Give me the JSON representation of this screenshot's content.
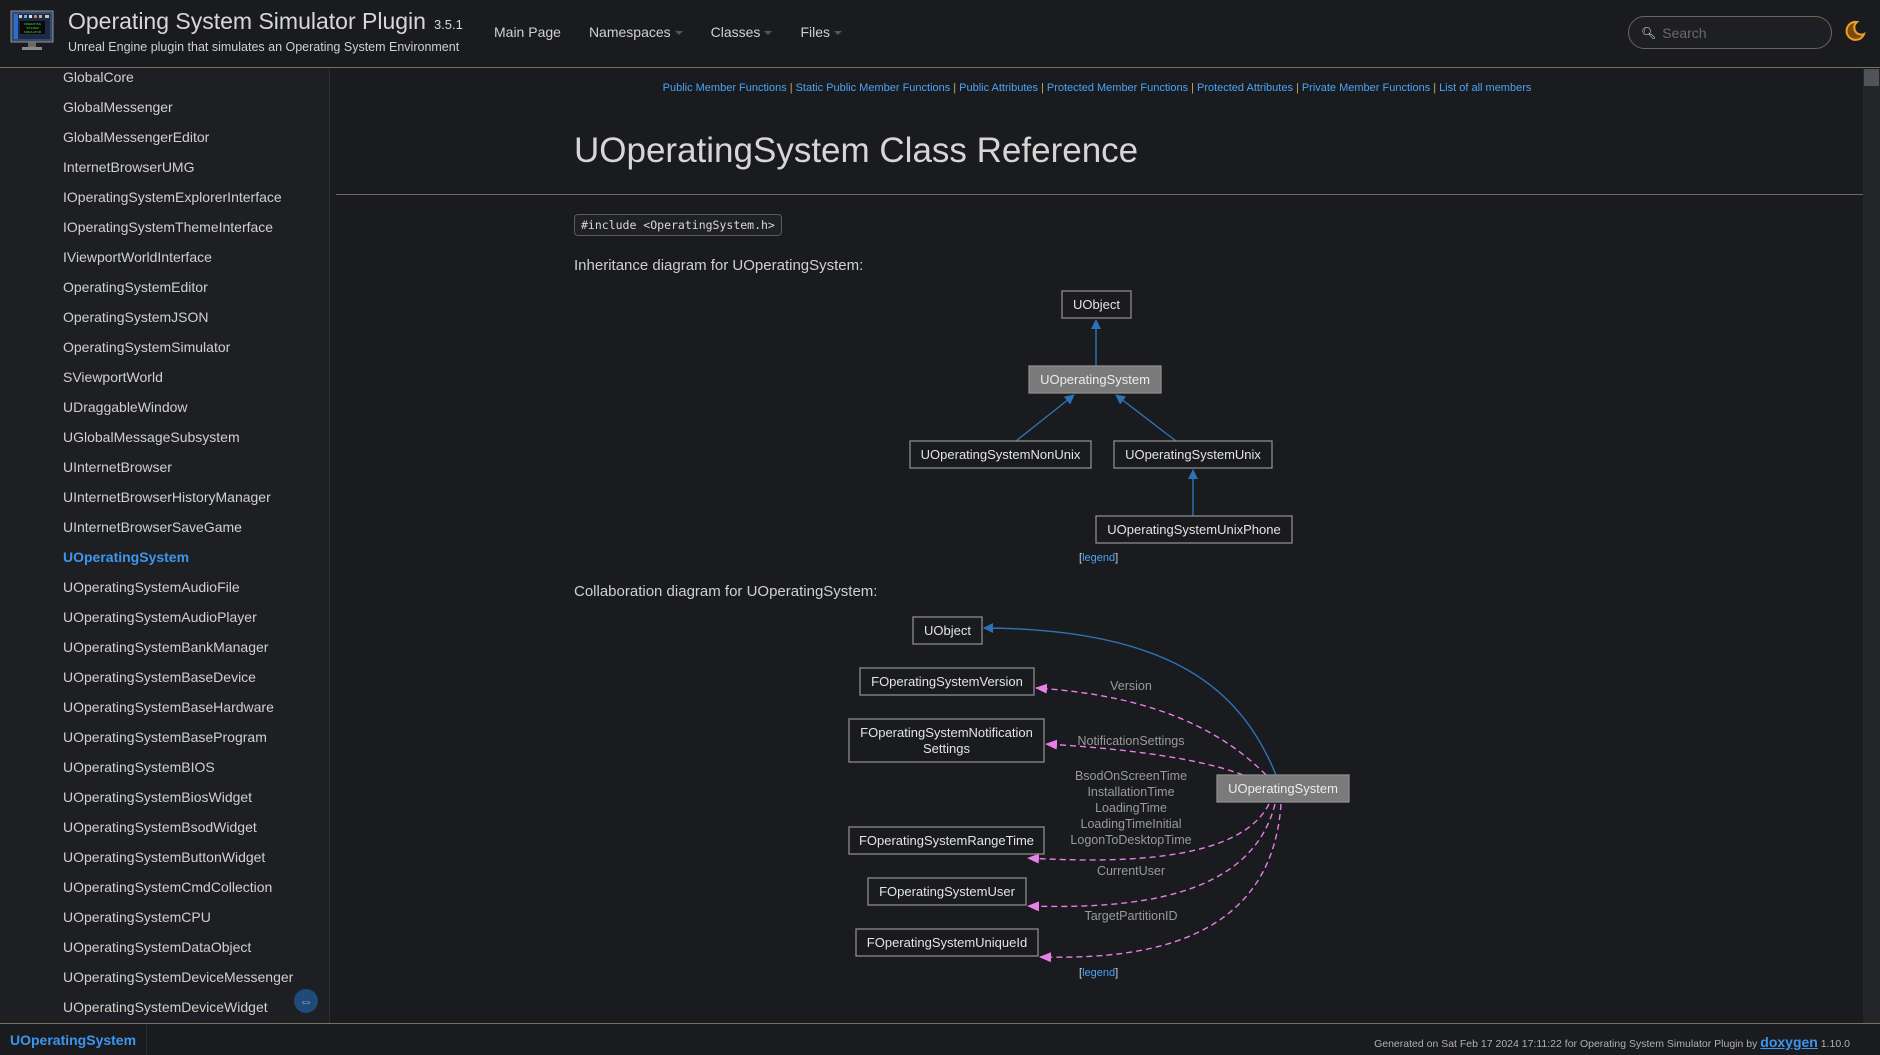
{
  "header": {
    "project_name": "Operating System Simulator Plugin",
    "project_number": "3.5.1",
    "project_brief": "Unreal Engine plugin that simulates an Operating System Environment",
    "logo_icon": "monitor-logo-icon",
    "menu": [
      {
        "label": "Main Page",
        "has_dropdown": false
      },
      {
        "label": "Namespaces",
        "has_dropdown": true
      },
      {
        "label": "Classes",
        "has_dropdown": true
      },
      {
        "label": "Files",
        "has_dropdown": true
      }
    ],
    "search": {
      "placeholder": "Search",
      "value": ""
    },
    "theme_toggle_icon": "moon-icon",
    "accent_color": "#3d96ee",
    "theme_icon_color": "#f0a020"
  },
  "sidebar": {
    "items": [
      {
        "label": "GlobalCore"
      },
      {
        "label": "GlobalMessenger"
      },
      {
        "label": "GlobalMessengerEditor"
      },
      {
        "label": "InternetBrowserUMG"
      },
      {
        "label": "IOperatingSystemExplorerInterface"
      },
      {
        "label": "IOperatingSystemThemeInterface"
      },
      {
        "label": "IViewportWorldInterface"
      },
      {
        "label": "OperatingSystemEditor"
      },
      {
        "label": "OperatingSystemJSON"
      },
      {
        "label": "OperatingSystemSimulator"
      },
      {
        "label": "SViewportWorld"
      },
      {
        "label": "UDraggableWindow"
      },
      {
        "label": "UGlobalMessageSubsystem"
      },
      {
        "label": "UInternetBrowser"
      },
      {
        "label": "UInternetBrowserHistoryManager"
      },
      {
        "label": "UInternetBrowserSaveGame"
      },
      {
        "label": "UOperatingSystem",
        "selected": true
      },
      {
        "label": "UOperatingSystemAudioFile"
      },
      {
        "label": "UOperatingSystemAudioPlayer"
      },
      {
        "label": "UOperatingSystemBankManager"
      },
      {
        "label": "UOperatingSystemBaseDevice"
      },
      {
        "label": "UOperatingSystemBaseHardware"
      },
      {
        "label": "UOperatingSystemBaseProgram"
      },
      {
        "label": "UOperatingSystemBIOS"
      },
      {
        "label": "UOperatingSystemBiosWidget"
      },
      {
        "label": "UOperatingSystemBsodWidget"
      },
      {
        "label": "UOperatingSystemButtonWidget"
      },
      {
        "label": "UOperatingSystemCmdCollection"
      },
      {
        "label": "UOperatingSystemCPU"
      },
      {
        "label": "UOperatingSystemDataObject"
      },
      {
        "label": "UOperatingSystemDeviceMessenger"
      },
      {
        "label": "UOperatingSystemDeviceWidget"
      }
    ],
    "sync_toggle_icon": "sync-arrows-icon"
  },
  "content": {
    "summary_links": [
      "Public Member Functions",
      "Static Public Member Functions",
      "Public Attributes",
      "Protected Member Functions",
      "Protected Attributes",
      "Private Member Functions",
      "List of all members"
    ],
    "title": "UOperatingSystem Class Reference",
    "include": "#include <OperatingSystem.h>",
    "inheritance_label": "Inheritance diagram for UOperatingSystem:",
    "inheritance": {
      "nodes": [
        {
          "id": "uobject",
          "label": "UObject",
          "highlight": false
        },
        {
          "id": "uos",
          "label": "UOperatingSystem",
          "highlight": true
        },
        {
          "id": "nonunix",
          "label": "UOperatingSystemNonUnix",
          "highlight": false
        },
        {
          "id": "unix",
          "label": "UOperatingSystemUnix",
          "highlight": false
        },
        {
          "id": "unixphone",
          "label": "UOperatingSystemUnixPhone",
          "highlight": false
        }
      ],
      "edges": [
        {
          "from": "uos",
          "to": "uobject"
        },
        {
          "from": "nonunix",
          "to": "uos"
        },
        {
          "from": "unix",
          "to": "uos"
        },
        {
          "from": "unixphone",
          "to": "unix"
        }
      ],
      "legend": "legend"
    },
    "collaboration_label": "Collaboration diagram for UOperatingSystem:",
    "collaboration": {
      "main_node": "UOperatingSystem",
      "nodes": [
        {
          "id": "uobject",
          "label": [
            "UObject"
          ]
        },
        {
          "id": "version",
          "label": [
            "FOperatingSystemVersion"
          ]
        },
        {
          "id": "notif",
          "label": [
            "FOperatingSystemNotification",
            "Settings"
          ]
        },
        {
          "id": "range",
          "label": [
            "FOperatingSystemRangeTime"
          ]
        },
        {
          "id": "user",
          "label": [
            "FOperatingSystemUser"
          ]
        },
        {
          "id": "uid",
          "label": [
            "FOperatingSystemUniqueId"
          ]
        }
      ],
      "edges": [
        {
          "to": "uobject",
          "kind": "inheritance",
          "labels": []
        },
        {
          "to": "version",
          "kind": "usage",
          "labels": [
            "Version"
          ]
        },
        {
          "to": "notif",
          "kind": "usage",
          "labels": [
            "NotificationSettings"
          ]
        },
        {
          "to": "range",
          "kind": "usage",
          "labels": [
            "BsodOnScreenTime",
            "InstallationTime",
            "LoadingTime",
            "LoadingTimeInitial",
            "LogonToDesktopTime"
          ]
        },
        {
          "to": "user",
          "kind": "usage",
          "labels": [
            "CurrentUser"
          ]
        },
        {
          "to": "uid",
          "kind": "usage",
          "labels": [
            "TargetPartitionID"
          ]
        }
      ],
      "legend": "legend"
    },
    "colors": {
      "link": "#4aa3f6",
      "inheritance_edge": "#2d72b8",
      "usage_edge": "#e87ee8",
      "node_highlight_bg": "#7a7a7a"
    }
  },
  "footer": {
    "nav_path": "UOperatingSystem",
    "generated_prefix": "Generated on Sat Feb 17 2024 17:11:22 for Operating System Simulator Plugin by",
    "generator": "doxygen",
    "generator_version": "1.10.0"
  }
}
